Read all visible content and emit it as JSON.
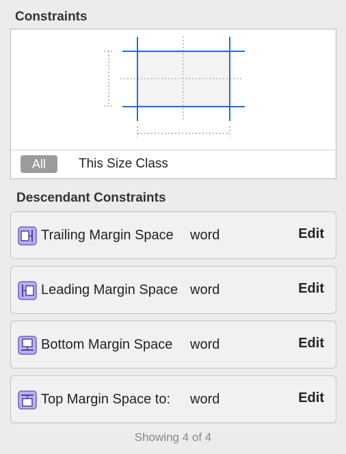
{
  "panel": {
    "constraints_title": "Constraints",
    "size_classes": {
      "all_label": "All",
      "this_label": "This Size Class"
    },
    "descendant_title": "Descendant Constraints",
    "rows": [
      {
        "name": "Trailing Margin Space",
        "target": "word",
        "edit": "Edit",
        "icon": "trailing-margin-icon"
      },
      {
        "name": "Leading Margin Space",
        "target": "word",
        "edit": "Edit",
        "icon": "leading-margin-icon"
      },
      {
        "name": "Bottom Margin Space",
        "target": "word",
        "edit": "Edit",
        "icon": "bottom-margin-icon"
      },
      {
        "name": "Top Margin Space to:",
        "target": "word",
        "edit": "Edit",
        "icon": "top-margin-icon"
      }
    ],
    "footer": "Showing 4 of 4"
  },
  "colors": {
    "constraint_blue": "#1f6fd6",
    "icon_purple": "#6e5fc6",
    "pill_gray": "#9b9b9b"
  }
}
